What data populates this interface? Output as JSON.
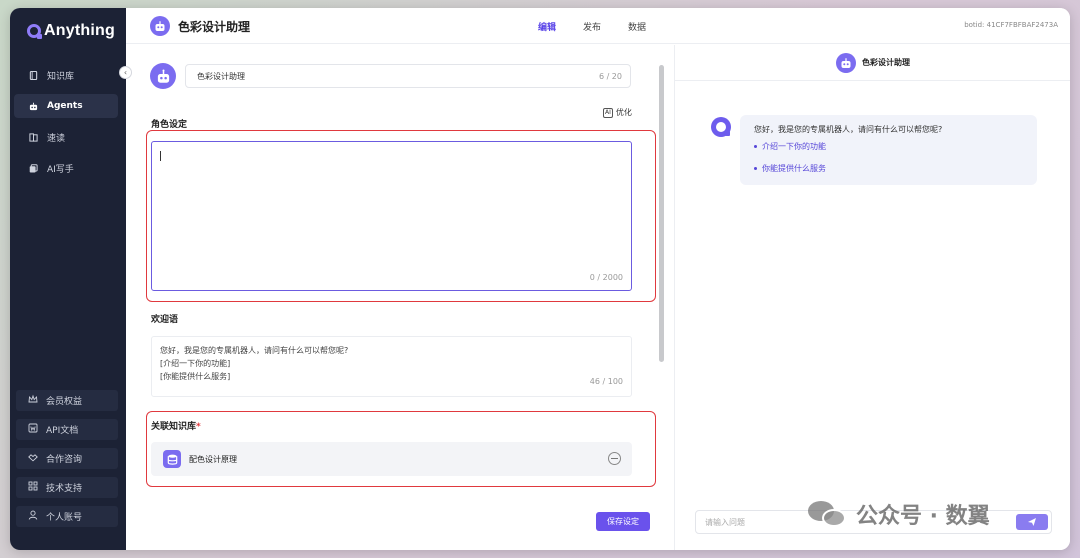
{
  "app": {
    "brand": "Anything"
  },
  "sidebar": {
    "items": [
      {
        "label": "知识库",
        "icon": "book-icon",
        "active": false
      },
      {
        "label": "Agents",
        "icon": "robot-icon",
        "active": true
      },
      {
        "label": "速读",
        "icon": "speed-read-icon",
        "active": false
      },
      {
        "label": "AI写手",
        "icon": "writer-icon",
        "active": false
      }
    ],
    "bottom": [
      {
        "label": "会员权益",
        "icon": "crown-icon"
      },
      {
        "label": "API文档",
        "icon": "doc-icon"
      },
      {
        "label": "合作咨询",
        "icon": "handshake-icon"
      },
      {
        "label": "技术支持",
        "icon": "grid-icon"
      },
      {
        "label": "个人账号",
        "icon": "user-icon"
      }
    ]
  },
  "header": {
    "title": "色彩设计助理",
    "tabs": [
      {
        "label": "编辑",
        "active": true
      },
      {
        "label": "发布",
        "active": false
      },
      {
        "label": "数据",
        "active": false
      }
    ],
    "botid": "botid: 41CF7FBFBAF2473A"
  },
  "editor": {
    "name_value": "色彩设计助理",
    "name_count": "6 / 20",
    "optimize_badge": "AI",
    "optimize_label": "优化",
    "role_label": "角色设定",
    "role_count": "0 / 2000",
    "welcome_label": "欢迎语",
    "welcome_lines": [
      "您好，我是您的专属机器人，请问有什么可以帮您呢?",
      "[介绍一下你的功能]",
      "[你能提供什么服务]"
    ],
    "welcome_count": "46 / 100",
    "kb_label": "关联知识库",
    "kb_required": "*",
    "kb_item": "配色设计原理",
    "save_label": "保存设定"
  },
  "preview": {
    "title": "色彩设计助理",
    "greeting": "您好，我是您的专属机器人，请问有什么可以帮您呢?",
    "suggestions": [
      "介绍一下你的功能",
      "你能提供什么服务"
    ],
    "input_placeholder": "请输入问题"
  },
  "watermark": {
    "text": "公众号 · 数翼"
  },
  "colors": {
    "accent": "#6a52ec",
    "sidebar_bg": "#1c2235",
    "highlight": "#e0393e"
  }
}
